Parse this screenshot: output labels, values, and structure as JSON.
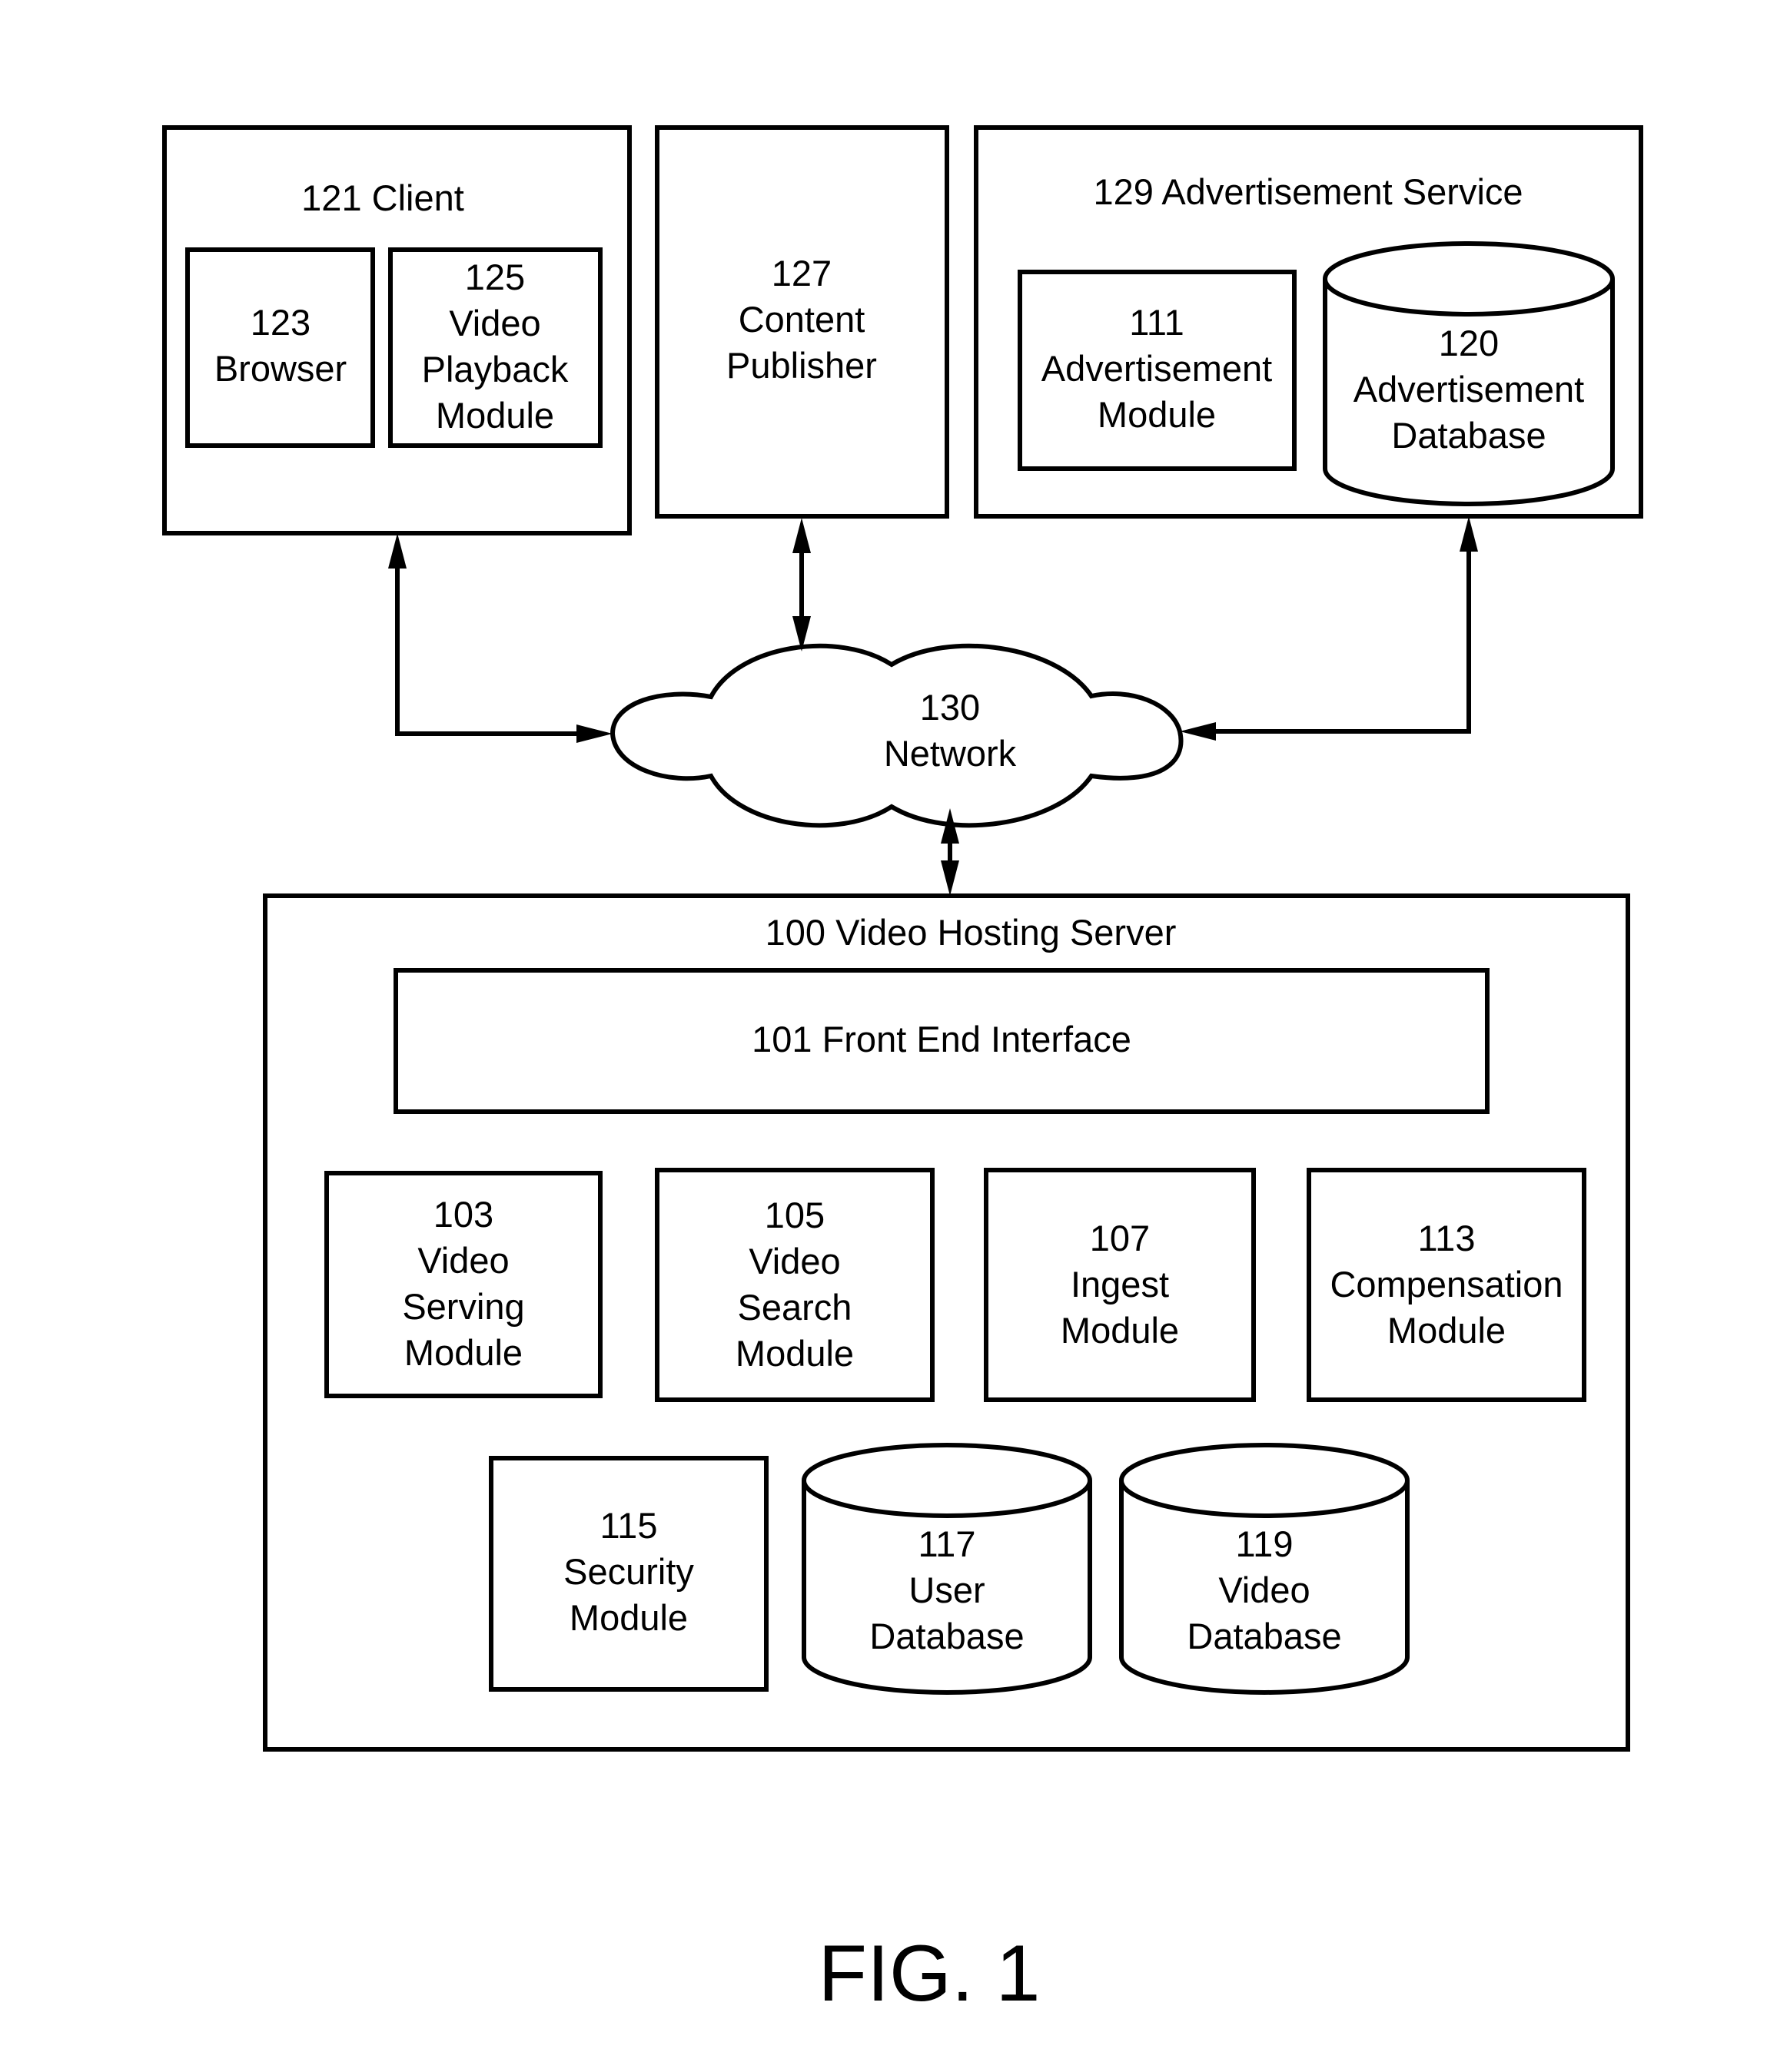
{
  "diagram": {
    "client": {
      "title": "121 Client",
      "browser": {
        "lines": [
          "123",
          "Browser"
        ]
      },
      "video_playback": {
        "lines": [
          "125",
          "Video",
          "Playback",
          "Module"
        ]
      }
    },
    "content_publisher": {
      "lines": [
        "127",
        "Content",
        "Publisher"
      ]
    },
    "advertisement_service": {
      "title": "129 Advertisement Service",
      "advertisement_module": {
        "lines": [
          "111",
          "Advertisement",
          "Module"
        ]
      },
      "advertisement_database": {
        "lines": [
          "120",
          "Advertisement",
          "Database"
        ]
      }
    },
    "network": {
      "lines": [
        "130",
        "Network"
      ]
    },
    "video_hosting_server": {
      "title": "100 Video Hosting Server",
      "front_end_interface": {
        "label": "101 Front End Interface"
      },
      "video_serving_module": {
        "lines": [
          "103",
          "Video",
          "Serving",
          "Module"
        ]
      },
      "video_search_module": {
        "lines": [
          "105",
          "Video",
          "Search",
          "Module"
        ]
      },
      "ingest_module": {
        "lines": [
          "107",
          "Ingest",
          "Module"
        ]
      },
      "compensation_module": {
        "lines": [
          "113",
          "Compensation",
          "Module"
        ]
      },
      "security_module": {
        "lines": [
          "115",
          "Security",
          "Module"
        ]
      },
      "user_database": {
        "lines": [
          "117",
          "User",
          "Database"
        ]
      },
      "video_database": {
        "lines": [
          "119",
          "Video",
          "Database"
        ]
      }
    },
    "connections": [
      {
        "from": "121 Client",
        "to": "130 Network",
        "direction": "bidirectional"
      },
      {
        "from": "127 Content Publisher",
        "to": "130 Network",
        "direction": "bidirectional"
      },
      {
        "from": "129 Advertisement Service",
        "to": "130 Network",
        "direction": "bidirectional"
      },
      {
        "from": "100 Video Hosting Server",
        "to": "130 Network",
        "direction": "bidirectional"
      }
    ],
    "figure_label": "FIG. 1"
  }
}
